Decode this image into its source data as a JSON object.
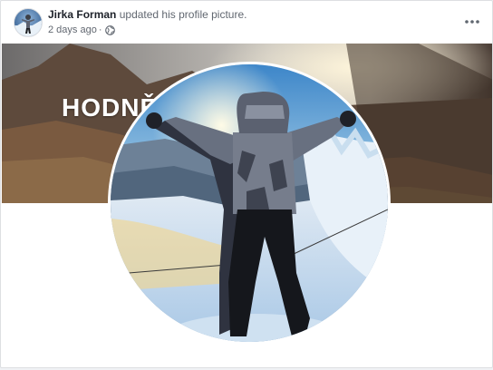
{
  "post": {
    "author": "Jirka Forman",
    "action": "updated his profile picture.",
    "time": "2 days ago",
    "separator": "·",
    "privacy_icon": "globe-icon",
    "menu_icon": "more-options-icon"
  },
  "cover": {
    "overlay_text": "HODNĚ B"
  },
  "colors": {
    "author_text": "#1d2129",
    "meta_text": "#616770",
    "card_border": "#dddfe2"
  }
}
